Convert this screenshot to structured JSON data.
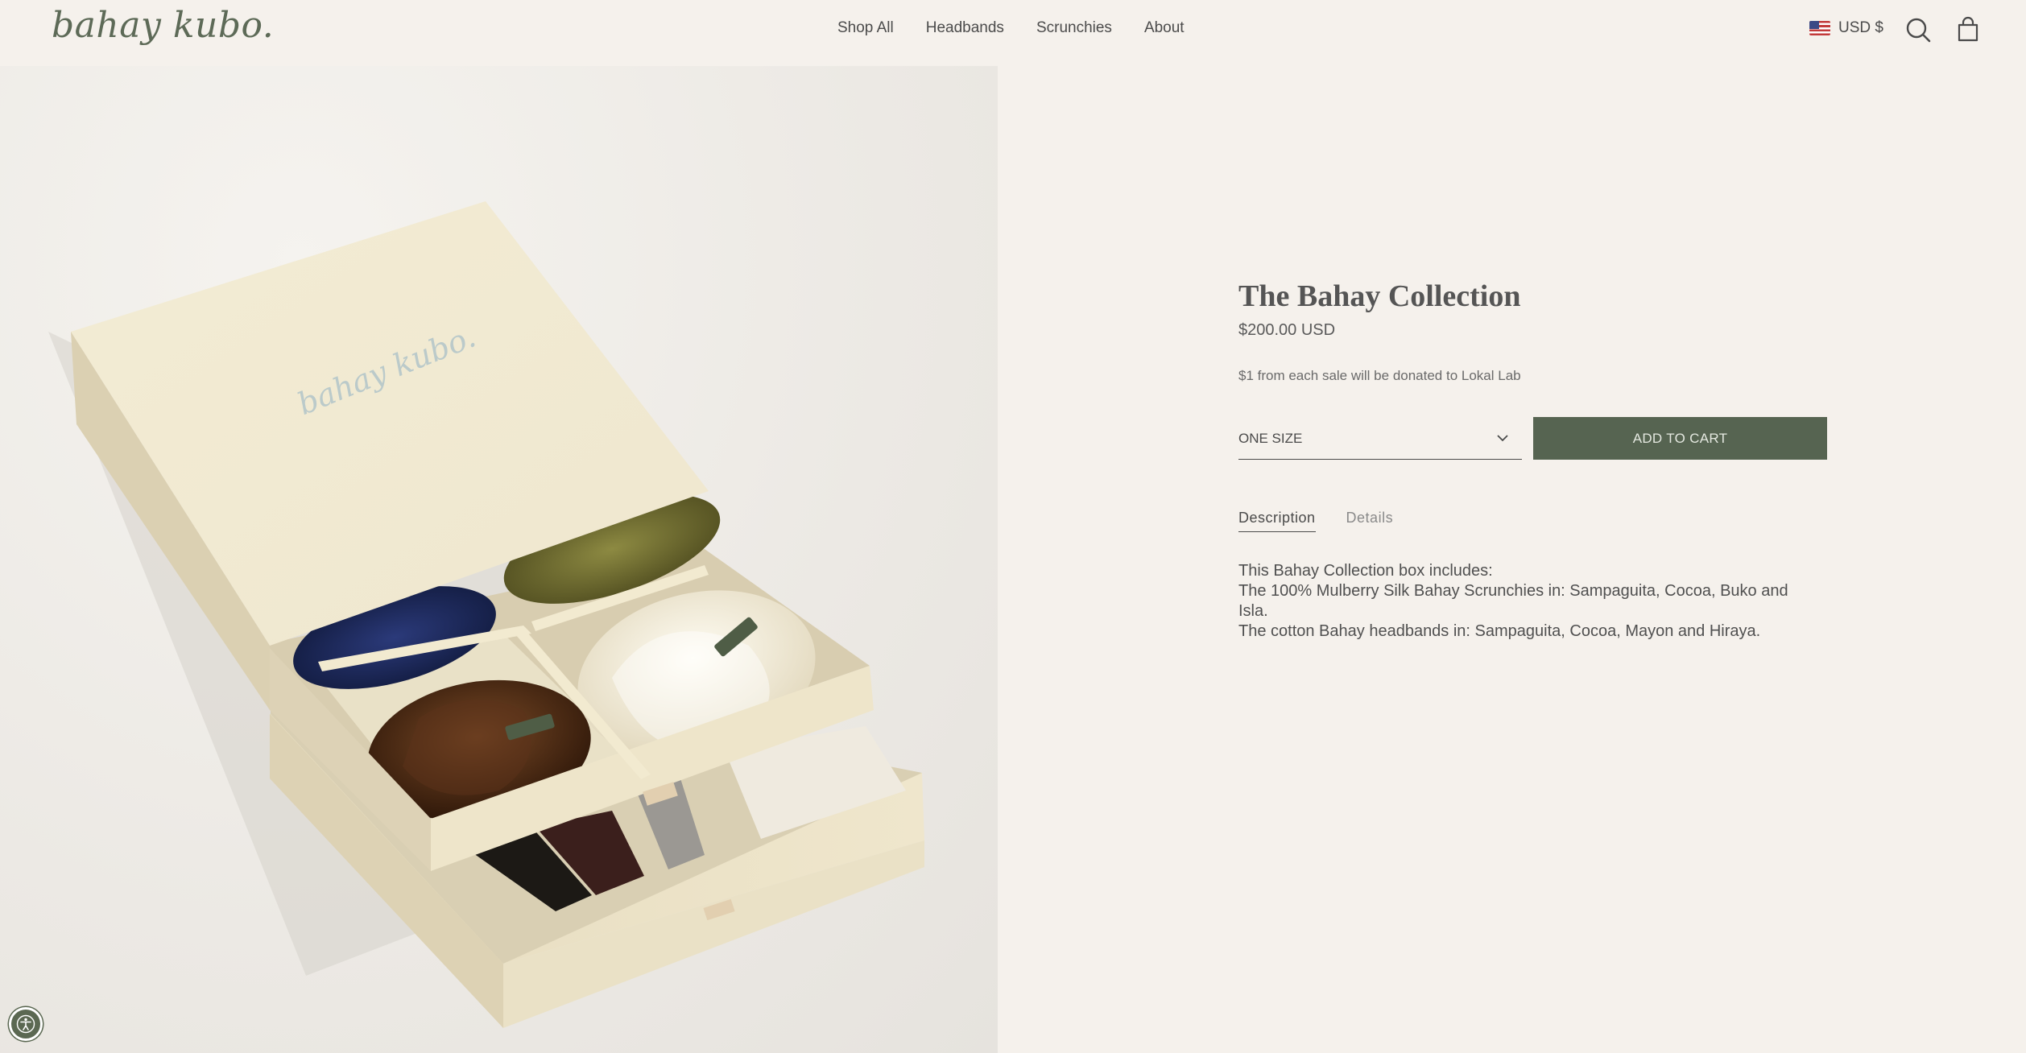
{
  "header": {
    "logo": "bahay kubo.",
    "nav": [
      {
        "label": "Shop All"
      },
      {
        "label": "Headbands"
      },
      {
        "label": "Scrunchies"
      },
      {
        "label": "About"
      }
    ],
    "currency": "USD $",
    "icons": {
      "flag": "us-flag-icon",
      "search": "search-icon",
      "cart": "bag-icon"
    }
  },
  "hero": {
    "box_logo": "bahay kubo.",
    "tag_text": "bahay kubo"
  },
  "product": {
    "title": "The Bahay Collection",
    "price": "$200.00 USD",
    "donation": "$1 from each sale will be donated to Lokal Lab",
    "size": "ONE SIZE",
    "add_to_cart": "ADD TO CART",
    "tabs": [
      {
        "label": "Description",
        "active": true
      },
      {
        "label": "Details",
        "active": false
      }
    ],
    "description": [
      "This Bahay Collection box includes:",
      "The 100% Mulberry Silk Bahay Scrunchies in: Sampaguita, Cocoa, Buko and Isla.",
      "The cotton Bahay headbands in: Sampaguita, Cocoa, Mayon and Hiraya."
    ]
  },
  "colors": {
    "background": "#f5f1ec",
    "accent": "#566451",
    "logo": "#5d6a57"
  },
  "accessibility": {
    "icon": "accessibility-icon"
  }
}
